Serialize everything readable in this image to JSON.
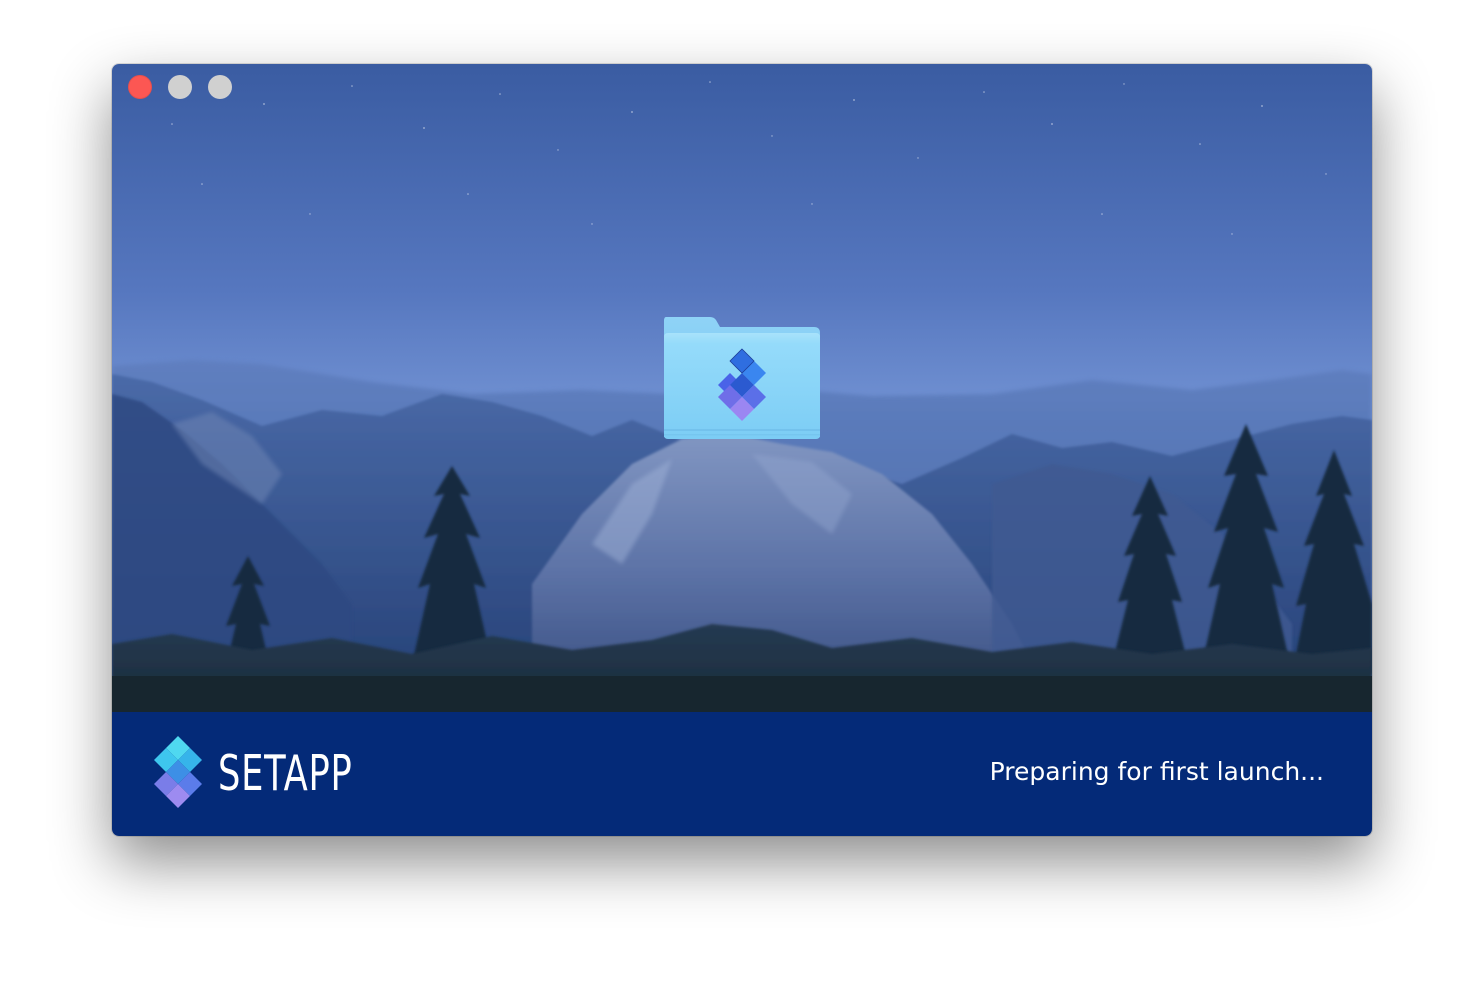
{
  "window": {
    "controls": [
      "close-button",
      "minimize-button",
      "maximize-button"
    ]
  },
  "installer": {
    "folder_icon": "setapp-folder-icon",
    "logo_icon": "setapp-diamond-icon",
    "brand_name": "SETAPP",
    "status_text": "Preparing for first launch..."
  },
  "colors": {
    "footer_background": "#042a78",
    "close_button": "#fc5753",
    "inactive_button": "#d0d0d0",
    "sky_top": "#3e63a8",
    "sky_horizon": "#86a8df"
  }
}
